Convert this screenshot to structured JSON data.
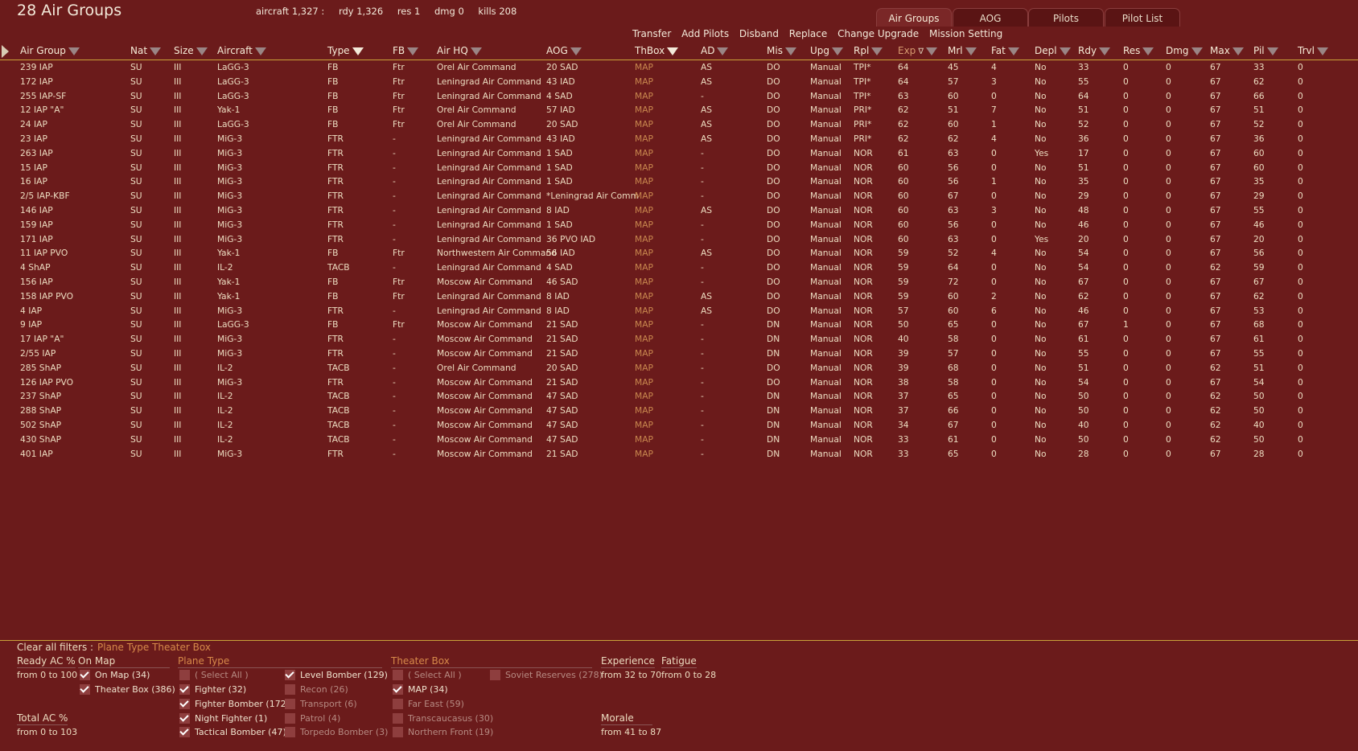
{
  "header": {
    "title": "28 Air Groups",
    "stats": [
      "aircraft 1,327 :",
      "rdy 1,326",
      "res 1",
      "dmg 0",
      "kills 208"
    ]
  },
  "tabs": [
    {
      "label": "Air Groups",
      "active": true
    },
    {
      "label": "AOG",
      "active": false
    },
    {
      "label": "Pilots",
      "active": false
    },
    {
      "label": "Pilot List",
      "active": false
    }
  ],
  "actions": [
    "Transfer",
    "Add Pilots",
    "Disband",
    "Replace",
    "Change Upgrade",
    "Mission Setting"
  ],
  "columns": [
    "Air Group",
    "Nat",
    "Size",
    "Aircraft",
    "Type",
    "FB",
    "Air HQ",
    "AOG",
    "ThBox",
    "AD",
    "Mis",
    "Upg",
    "Rpl",
    "Exp",
    "Mrl",
    "Fat",
    "Depl",
    "Rdy",
    "Res",
    "Dmg",
    "Max",
    "Pil",
    "Trvl"
  ],
  "rows": [
    [
      "239 IAP",
      "SU",
      "III",
      "LaGG-3",
      "FB",
      "Ftr",
      "Orel Air Command",
      "20 SAD",
      "MAP",
      "AS",
      "DO",
      "Manual",
      "TPI*",
      "64",
      "45",
      "4",
      "No",
      "33",
      "0",
      "0",
      "67",
      "33",
      "0"
    ],
    [
      "172 IAP",
      "SU",
      "III",
      "LaGG-3",
      "FB",
      "Ftr",
      "Leningrad Air Command",
      "43 IAD",
      "MAP",
      "AS",
      "DO",
      "Manual",
      "TPI*",
      "64",
      "57",
      "3",
      "No",
      "55",
      "0",
      "0",
      "67",
      "62",
      "0"
    ],
    [
      "255 IAP-SF",
      "SU",
      "III",
      "LaGG-3",
      "FB",
      "Ftr",
      "Leningrad Air Command",
      "4 SAD",
      "MAP",
      "-",
      "DO",
      "Manual",
      "TPI*",
      "63",
      "60",
      "0",
      "No",
      "64",
      "0",
      "0",
      "67",
      "66",
      "0"
    ],
    [
      "12 IAP \"A\"",
      "SU",
      "III",
      "Yak-1",
      "FB",
      "Ftr",
      "Orel Air Command",
      "57 IAD",
      "MAP",
      "AS",
      "DO",
      "Manual",
      "PRI*",
      "62",
      "51",
      "7",
      "No",
      "51",
      "0",
      "0",
      "67",
      "51",
      "0"
    ],
    [
      "24 IAP",
      "SU",
      "III",
      "LaGG-3",
      "FB",
      "Ftr",
      "Orel Air Command",
      "20 SAD",
      "MAP",
      "AS",
      "DO",
      "Manual",
      "PRI*",
      "62",
      "60",
      "1",
      "No",
      "52",
      "0",
      "0",
      "67",
      "52",
      "0"
    ],
    [
      "23 IAP",
      "SU",
      "III",
      "MiG-3",
      "FTR",
      "-",
      "Leningrad Air Command",
      "43 IAD",
      "MAP",
      "AS",
      "DO",
      "Manual",
      "PRI*",
      "62",
      "62",
      "4",
      "No",
      "36",
      "0",
      "0",
      "67",
      "36",
      "0"
    ],
    [
      "263 IAP",
      "SU",
      "III",
      "MiG-3",
      "FTR",
      "-",
      "Leningrad Air Command",
      "1 SAD",
      "MAP",
      "-",
      "DO",
      "Manual",
      "NOR",
      "61",
      "63",
      "0",
      "Yes",
      "17",
      "0",
      "0",
      "67",
      "60",
      "0"
    ],
    [
      "15 IAP",
      "SU",
      "III",
      "MiG-3",
      "FTR",
      "-",
      "Leningrad Air Command",
      "1 SAD",
      "MAP",
      "-",
      "DO",
      "Manual",
      "NOR",
      "60",
      "56",
      "0",
      "No",
      "51",
      "0",
      "0",
      "67",
      "60",
      "0"
    ],
    [
      "16 IAP",
      "SU",
      "III",
      "MiG-3",
      "FTR",
      "-",
      "Leningrad Air Command",
      "1 SAD",
      "MAP",
      "-",
      "DO",
      "Manual",
      "NOR",
      "60",
      "56",
      "1",
      "No",
      "35",
      "0",
      "0",
      "67",
      "35",
      "0"
    ],
    [
      "2/5 IAP-KBF",
      "SU",
      "III",
      "MiG-3",
      "FTR",
      "-",
      "Leningrad Air Command",
      "*Leningrad Air Comm",
      "MAP",
      "-",
      "DO",
      "Manual",
      "NOR",
      "60",
      "67",
      "0",
      "No",
      "29",
      "0",
      "0",
      "67",
      "29",
      "0"
    ],
    [
      "146 IAP",
      "SU",
      "III",
      "MiG-3",
      "FTR",
      "-",
      "Leningrad Air Command",
      "8 IAD",
      "MAP",
      "AS",
      "DO",
      "Manual",
      "NOR",
      "60",
      "63",
      "3",
      "No",
      "48",
      "0",
      "0",
      "67",
      "55",
      "0"
    ],
    [
      "159 IAP",
      "SU",
      "III",
      "MiG-3",
      "FTR",
      "-",
      "Leningrad Air Command",
      "1 SAD",
      "MAP",
      "-",
      "DO",
      "Manual",
      "NOR",
      "60",
      "56",
      "0",
      "No",
      "46",
      "0",
      "0",
      "67",
      "46",
      "0"
    ],
    [
      "171 IAP",
      "SU",
      "III",
      "MiG-3",
      "FTR",
      "-",
      "Leningrad Air Command",
      "36 PVO IAD",
      "MAP",
      "-",
      "DO",
      "Manual",
      "NOR",
      "60",
      "63",
      "0",
      "Yes",
      "20",
      "0",
      "0",
      "67",
      "20",
      "0"
    ],
    [
      "11 IAP PVO",
      "SU",
      "III",
      "Yak-1",
      "FB",
      "Ftr",
      "Northwestern Air Command",
      "56 IAD",
      "MAP",
      "AS",
      "DO",
      "Manual",
      "NOR",
      "59",
      "52",
      "4",
      "No",
      "54",
      "0",
      "0",
      "67",
      "56",
      "0"
    ],
    [
      "4 ShAP",
      "SU",
      "III",
      "IL-2",
      "TACB",
      "-",
      "Leningrad Air Command",
      "4 SAD",
      "MAP",
      "-",
      "DO",
      "Manual",
      "NOR",
      "59",
      "64",
      "0",
      "No",
      "54",
      "0",
      "0",
      "62",
      "59",
      "0"
    ],
    [
      "156 IAP",
      "SU",
      "III",
      "Yak-1",
      "FB",
      "Ftr",
      "Moscow Air Command",
      "46 SAD",
      "MAP",
      "-",
      "DO",
      "Manual",
      "NOR",
      "59",
      "72",
      "0",
      "No",
      "67",
      "0",
      "0",
      "67",
      "67",
      "0"
    ],
    [
      "158 IAP PVO",
      "SU",
      "III",
      "Yak-1",
      "FB",
      "Ftr",
      "Leningrad Air Command",
      "8 IAD",
      "MAP",
      "AS",
      "DO",
      "Manual",
      "NOR",
      "59",
      "60",
      "2",
      "No",
      "62",
      "0",
      "0",
      "67",
      "62",
      "0"
    ],
    [
      "4 IAP",
      "SU",
      "III",
      "MiG-3",
      "FTR",
      "-",
      "Leningrad Air Command",
      "8 IAD",
      "MAP",
      "AS",
      "DO",
      "Manual",
      "NOR",
      "57",
      "60",
      "6",
      "No",
      "46",
      "0",
      "0",
      "67",
      "53",
      "0"
    ],
    [
      "9 IAP",
      "SU",
      "III",
      "LaGG-3",
      "FB",
      "Ftr",
      "Moscow Air Command",
      "21 SAD",
      "MAP",
      "-",
      "DN",
      "Manual",
      "NOR",
      "50",
      "65",
      "0",
      "No",
      "67",
      "1",
      "0",
      "67",
      "68",
      "0"
    ],
    [
      "17 IAP \"A\"",
      "SU",
      "III",
      "MiG-3",
      "FTR",
      "-",
      "Moscow Air Command",
      "21 SAD",
      "MAP",
      "-",
      "DN",
      "Manual",
      "NOR",
      "40",
      "58",
      "0",
      "No",
      "61",
      "0",
      "0",
      "67",
      "61",
      "0"
    ],
    [
      "2/55 IAP",
      "SU",
      "III",
      "MiG-3",
      "FTR",
      "-",
      "Moscow Air Command",
      "21 SAD",
      "MAP",
      "-",
      "DN",
      "Manual",
      "NOR",
      "39",
      "57",
      "0",
      "No",
      "55",
      "0",
      "0",
      "67",
      "55",
      "0"
    ],
    [
      "285 ShAP",
      "SU",
      "III",
      "IL-2",
      "TACB",
      "-",
      "Orel Air Command",
      "20 SAD",
      "MAP",
      "-",
      "DO",
      "Manual",
      "NOR",
      "39",
      "68",
      "0",
      "No",
      "51",
      "0",
      "0",
      "62",
      "51",
      "0"
    ],
    [
      "126 IAP PVO",
      "SU",
      "III",
      "MiG-3",
      "FTR",
      "-",
      "Moscow Air Command",
      "21 SAD",
      "MAP",
      "-",
      "DO",
      "Manual",
      "NOR",
      "38",
      "58",
      "0",
      "No",
      "54",
      "0",
      "0",
      "67",
      "54",
      "0"
    ],
    [
      "237 ShAP",
      "SU",
      "III",
      "IL-2",
      "TACB",
      "-",
      "Moscow Air Command",
      "47 SAD",
      "MAP",
      "-",
      "DN",
      "Manual",
      "NOR",
      "37",
      "65",
      "0",
      "No",
      "50",
      "0",
      "0",
      "62",
      "50",
      "0"
    ],
    [
      "288 ShAP",
      "SU",
      "III",
      "IL-2",
      "TACB",
      "-",
      "Moscow Air Command",
      "47 SAD",
      "MAP",
      "-",
      "DN",
      "Manual",
      "NOR",
      "37",
      "66",
      "0",
      "No",
      "50",
      "0",
      "0",
      "62",
      "50",
      "0"
    ],
    [
      "502 ShAP",
      "SU",
      "III",
      "IL-2",
      "TACB",
      "-",
      "Moscow Air Command",
      "47 SAD",
      "MAP",
      "-",
      "DN",
      "Manual",
      "NOR",
      "34",
      "67",
      "0",
      "No",
      "40",
      "0",
      "0",
      "62",
      "40",
      "0"
    ],
    [
      "430 ShAP",
      "SU",
      "III",
      "IL-2",
      "TACB",
      "-",
      "Moscow Air Command",
      "47 SAD",
      "MAP",
      "-",
      "DN",
      "Manual",
      "NOR",
      "33",
      "61",
      "0",
      "No",
      "50",
      "0",
      "0",
      "62",
      "50",
      "0"
    ],
    [
      "401 IAP",
      "SU",
      "III",
      "MiG-3",
      "FTR",
      "-",
      "Moscow Air Command",
      "21 SAD",
      "MAP",
      "-",
      "DN",
      "Manual",
      "NOR",
      "33",
      "65",
      "0",
      "No",
      "28",
      "0",
      "0",
      "67",
      "28",
      "0"
    ]
  ],
  "filters": {
    "clear_label": "Clear all filters :",
    "active_summary": "Plane Type Theater Box",
    "ready_ac": {
      "label": "Ready AC %",
      "range": "from 0 to 100"
    },
    "total_ac": {
      "label": "Total AC %",
      "range": "from 0 to 103"
    },
    "on_map": {
      "label": "On Map",
      "options": [
        {
          "label": "On Map (34)",
          "checked": true
        },
        {
          "label": "Theater Box (386)",
          "checked": true
        }
      ]
    },
    "plane_type": {
      "label": "Plane Type",
      "options": [
        {
          "label": "( Select All )",
          "checked": false
        },
        {
          "label": "Fighter (32)",
          "checked": true
        },
        {
          "label": "Fighter Bomber (172)",
          "checked": true
        },
        {
          "label": "Night Fighter (1)",
          "checked": true
        },
        {
          "label": "Tactical Bomber (47)",
          "checked": true
        },
        {
          "label": "Level Bomber (129)",
          "checked": true
        },
        {
          "label": "Recon (26)",
          "checked": false
        },
        {
          "label": "Transport (6)",
          "checked": false
        },
        {
          "label": "Patrol (4)",
          "checked": false
        },
        {
          "label": "Torpedo Bomber (3)",
          "checked": false
        }
      ]
    },
    "theater_box": {
      "label": "Theater Box",
      "options": [
        {
          "label": "( Select All )",
          "checked": false
        },
        {
          "label": "MAP (34)",
          "checked": true
        },
        {
          "label": "Far East (59)",
          "checked": false
        },
        {
          "label": "Transcaucasus (30)",
          "checked": false
        },
        {
          "label": "Northern Front (19)",
          "checked": false
        },
        {
          "label": "Soviet Reserves (278)",
          "checked": false
        }
      ]
    },
    "experience": {
      "label": "Experience",
      "range": "from 32 to 70"
    },
    "fatigue": {
      "label": "Fatigue",
      "range": "from 0 to 28"
    },
    "morale": {
      "label": "Morale",
      "range": "from 41 to 87"
    }
  }
}
